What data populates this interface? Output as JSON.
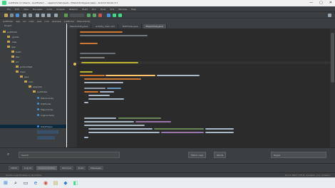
{
  "window": {
    "title": "pubfinder [C:\\Users\\...\\pubfinder] - ...\\app\\src\\main\\java\\...\\MainActivity.java [app] - Android Studio 3.1",
    "controls": [
      "—",
      "▢",
      "✕"
    ]
  },
  "menu": [
    "File",
    "Edit",
    "View",
    "Navigate",
    "Code",
    "Analyze",
    "Refactor",
    "Build",
    "Run",
    "Tools",
    "VCS",
    "Window",
    "Help"
  ],
  "navbar": [
    "pubfinder",
    "app",
    "src",
    "main",
    "java",
    "com",
    "example",
    "pubfinder",
    "MainActivity"
  ],
  "project": {
    "header": "Project",
    "tree": [
      "pubfinder",
      ".gradle",
      ".idea",
      "app",
      "build",
      "libs",
      "src",
      "androidTest",
      "main",
      "java",
      "com",
      "example",
      "pubfinder",
      "MainActivity",
      "PubFinder",
      "MapActivity",
      "LoginActivity",
      "DataHelper"
    ]
  },
  "tabs": [
    "MainActivity.java",
    "activity_main.xml",
    "PubFinder.java",
    "MapActivity.java"
  ],
  "bottom": {
    "search_value": "Search",
    "buttons": [
      "Match case",
      "Words",
      "Regex"
    ]
  },
  "toolwindows": [
    "TODO",
    "Logcat",
    "Android Profiler",
    "Terminal",
    "Build",
    "Messages"
  ],
  "status": {
    "left": "Gradle build finished in 4s 210ms",
    "right": "22:47  CRLF:  UTF-8:  Context: <no context>"
  },
  "taskbar_icons": [
    "⊞",
    "⌕",
    "▭",
    "e",
    "◉",
    "▤",
    "◆",
    "◧"
  ],
  "colors": {
    "background": "#2b2b2b",
    "keyword": "#cc7832",
    "string": "#6a8759",
    "identifier": "#a9b7c6",
    "annotation": "#bbb529",
    "selection": "#0d293e"
  }
}
